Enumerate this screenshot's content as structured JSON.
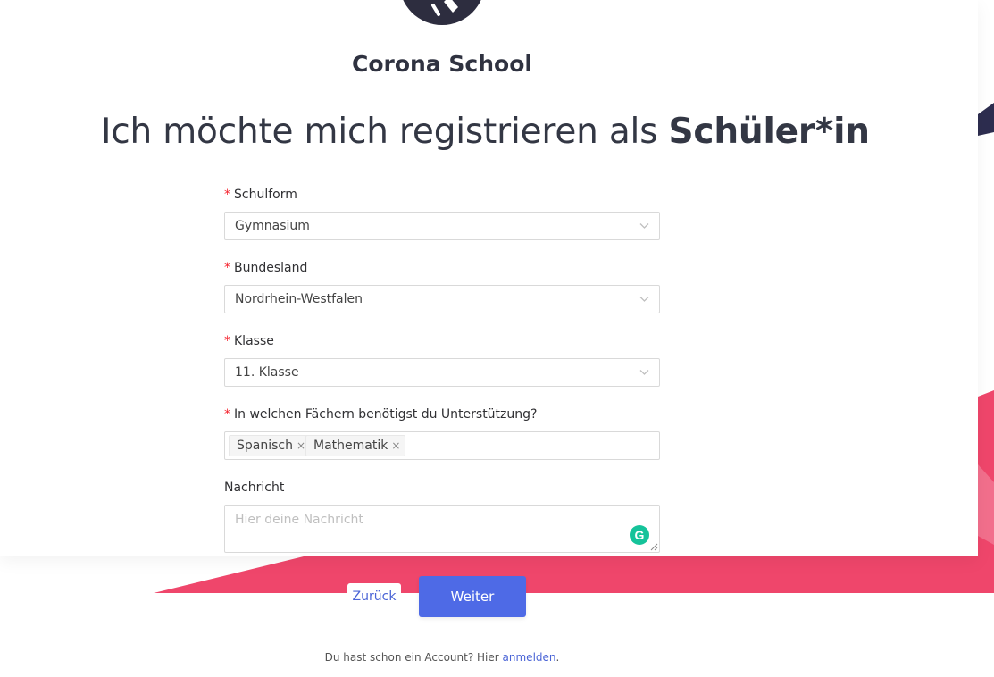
{
  "brand": {
    "name": "Corona School"
  },
  "heading": {
    "prefix": "Ich möchte mich registrieren als",
    "role": "Schüler*in"
  },
  "form": {
    "required_marker": "*",
    "schulform": {
      "label": "Schulform",
      "value": "Gymnasium"
    },
    "bundesland": {
      "label": "Bundesland",
      "value": "Nordrhein-Westfalen"
    },
    "klasse": {
      "label": "Klasse",
      "value": "11. Klasse"
    },
    "faecher": {
      "label": "In welchen Fächern benötigst du Unterstützung?",
      "tags": [
        "Spanisch",
        "Mathematik"
      ],
      "remove_glyph": "×"
    },
    "nachricht": {
      "label": "Nachricht",
      "placeholder": "Hier deine Nachricht"
    }
  },
  "buttons": {
    "back": "Zurück",
    "next": "Weiter"
  },
  "footer": {
    "text": "Du hast schon ein Account? Hier",
    "link": "anmelden",
    "suffix": "."
  },
  "icons": {
    "grammarly": "grammarly-icon",
    "chevron": "chevron-down-icon",
    "remove": "close-icon",
    "logo": "logo-icon"
  },
  "colors": {
    "accent": "#4e6ae6",
    "link": "#4a64d6",
    "required": "#f5222d",
    "decor_pink": "#ef466b",
    "decor_yellow": "#ffd95a",
    "decor_navy": "#2d2d4f",
    "logo_bg": "#2d2d3f",
    "grammarly": "#15c39a"
  }
}
